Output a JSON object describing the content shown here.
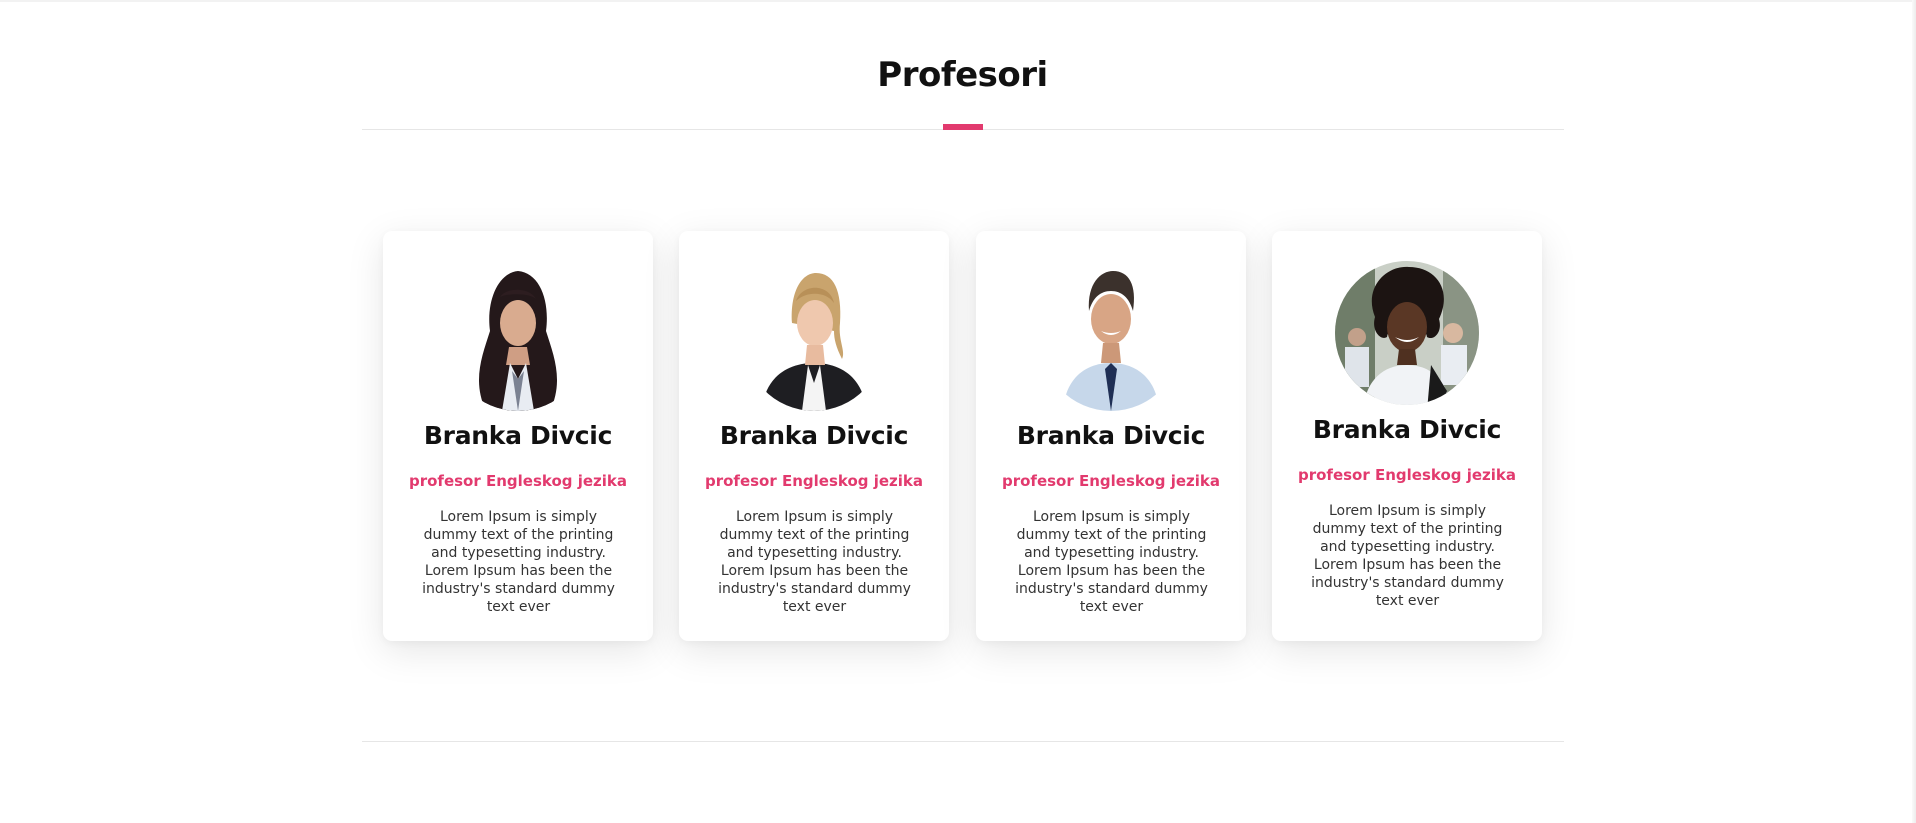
{
  "section": {
    "title": "Profesori"
  },
  "teachers": [
    {
      "name": "Branka Divcic",
      "role": "profesor Engleskog jezika",
      "description": "Lorem Ipsum is simply dummy text of the printing and typesetting industry. Lorem Ipsum has been the industry's standard dummy text ever"
    },
    {
      "name": "Branka Divcic",
      "role": "profesor Engleskog jezika",
      "description": "Lorem Ipsum is simply dummy text of the printing and typesetting industry. Lorem Ipsum has been the industry's standard dummy text ever"
    },
    {
      "name": "Branka Divcic",
      "role": "profesor Engleskog jezika",
      "description": "Lorem Ipsum is simply dummy text of the printing and typesetting industry. Lorem Ipsum has been the industry's standard dummy text ever"
    },
    {
      "name": "Branka Divcic",
      "role": "profesor Engleskog jezika",
      "description": "Lorem Ipsum is simply dummy text of the printing and typesetting industry. Lorem Ipsum has been the industry's standard dummy text ever"
    }
  ],
  "colors": {
    "accent": "#e23a6e",
    "heading": "#111111",
    "body_text": "#333333",
    "divider": "#e6e6e6"
  }
}
